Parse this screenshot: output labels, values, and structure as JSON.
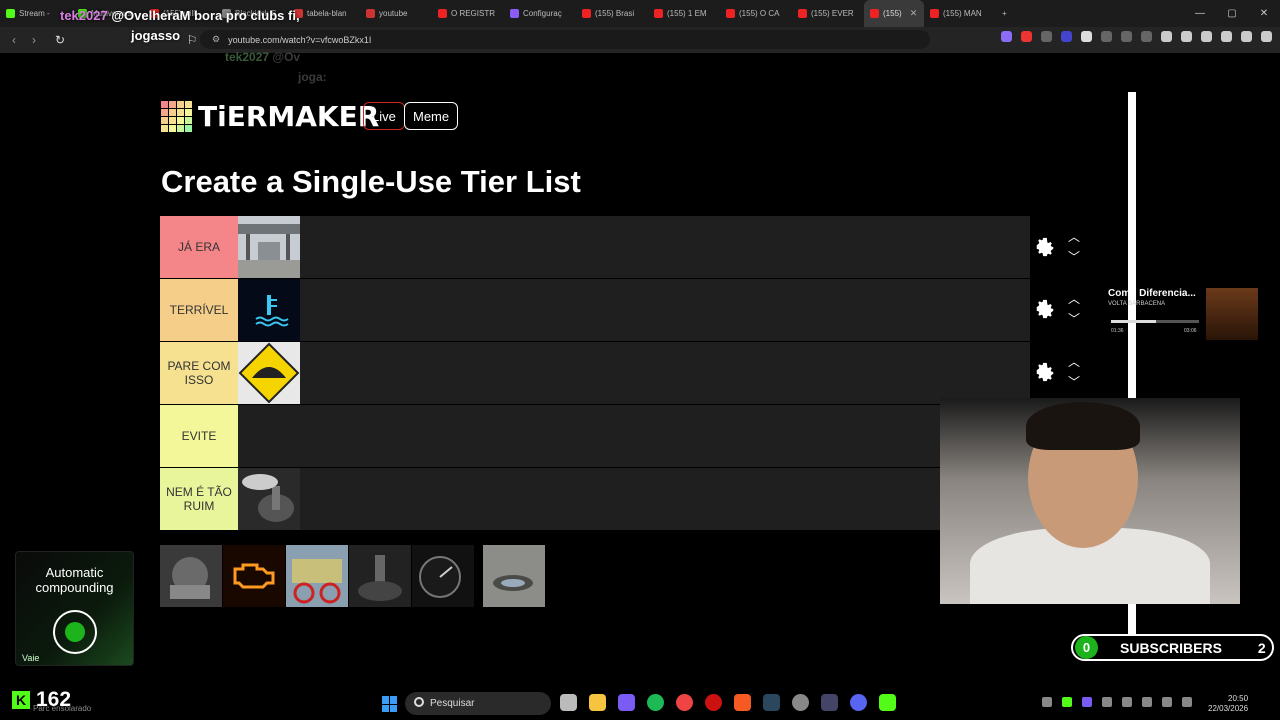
{
  "browser": {
    "tabs": [
      {
        "label": "Stream - ",
        "color": "#53fc18"
      },
      {
        "label": "Multiversus",
        "color": "#53fc18"
      },
      {
        "label": "(155) will",
        "color": "#e22"
      },
      {
        "label": "Blackjack S",
        "color": "#888"
      },
      {
        "label": "tabela-blan",
        "color": "#c33"
      },
      {
        "label": "youtube",
        "color": "#c33"
      },
      {
        "label": "O REGISTR",
        "color": "#e22"
      },
      {
        "label": "Configuraç",
        "color": "#8a5cf5"
      },
      {
        "label": "(155) Brasi",
        "color": "#e22"
      },
      {
        "label": "(155) 1 EM",
        "color": "#e22"
      },
      {
        "label": "(155) O CA",
        "color": "#e22"
      },
      {
        "label": "(155) EVER",
        "color": "#e22"
      },
      {
        "label": "(155)",
        "color": "#e22",
        "active": true
      },
      {
        "label": "(155) MAN",
        "color": "#e22"
      }
    ],
    "url": "youtube.com/watch?v=vfcwoBZkx1I"
  },
  "chat": {
    "line1_user": "tek2027",
    "line1_text": "@OvelheraM bora pro clubs fi,",
    "line2_text": "jogasso",
    "ghost_user": "tek2027",
    "ghost_text": "@Ov",
    "ghost_text2": "joga:"
  },
  "tiermaker": {
    "logo_text": "TiERMAKER",
    "live_label": "Live",
    "meme_label": "Meme",
    "page_title": "Create a Single-Use Tier List",
    "tiers": [
      {
        "label": "JÁ ERA",
        "color": "#f4868a"
      },
      {
        "label": "TERRÍVEL",
        "color": "#f5cf8a"
      },
      {
        "label": "PARE COM ISSO",
        "color": "#f5e190"
      },
      {
        "label": "EVITE",
        "color": "#f3f79a"
      },
      {
        "label": "NEM É TÃO RUIM",
        "color": "#e8f59a"
      }
    ]
  },
  "music": {
    "title": "Como Diferencia...",
    "artist": "VOLTA BARBACENA",
    "elapsed": "01:36",
    "duration": "03:06",
    "progress": 0.51
  },
  "subs": {
    "left": "0",
    "label": "SUBSCRIBERS",
    "count": "2"
  },
  "promo": {
    "heading": "Automatic compounding",
    "vaie": "Vaie"
  },
  "kick": {
    "count": "162",
    "sub": "Parc ensolarado"
  },
  "taskbar": {
    "search_placeholder": "Pesquisar",
    "time": "20:50",
    "date": "22/03/2026"
  }
}
